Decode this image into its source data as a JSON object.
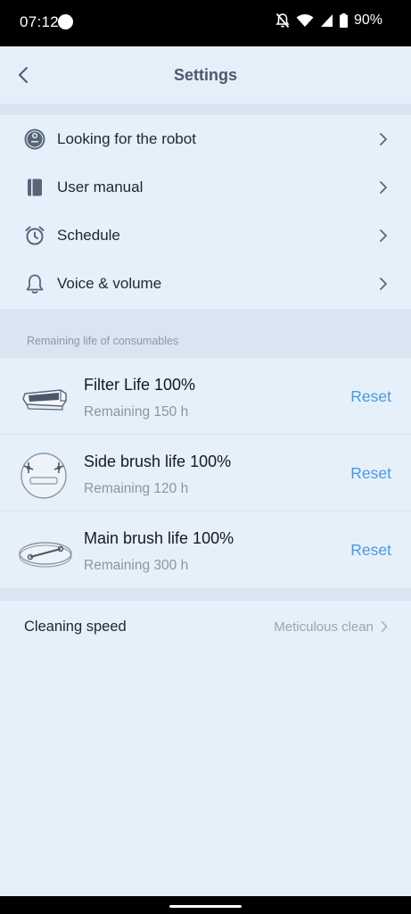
{
  "status_bar": {
    "time": "07:12",
    "battery": "90%"
  },
  "header": {
    "title": "Settings",
    "back_icon": "chevron-left-icon"
  },
  "menu": {
    "items": [
      {
        "label": "Looking for the robot",
        "icon": "robot-icon"
      },
      {
        "label": "User manual",
        "icon": "book-icon"
      },
      {
        "label": "Schedule",
        "icon": "alarm-clock-icon"
      },
      {
        "label": "Voice & volume",
        "icon": "bell-icon"
      }
    ]
  },
  "consumables": {
    "section_label": "Remaining life of consumables",
    "items": [
      {
        "title": "Filter Life 100%",
        "remaining": "Remaining 150 h",
        "reset_label": "Reset",
        "icon": "filter-icon",
        "life_percent": 100
      },
      {
        "title": "Side brush life 100%",
        "remaining": "Remaining 120 h",
        "reset_label": "Reset",
        "icon": "side-brush-icon",
        "life_percent": 100
      },
      {
        "title": "Main brush life 100%",
        "remaining": "Remaining 300 h",
        "reset_label": "Reset",
        "icon": "main-brush-icon",
        "life_percent": 100
      }
    ]
  },
  "cleaning_speed": {
    "label": "Cleaning speed",
    "value": "Meticulous clean"
  },
  "colors": {
    "background": "#e4effa",
    "accent": "#4a98e0",
    "title": "#4a5a6e"
  }
}
